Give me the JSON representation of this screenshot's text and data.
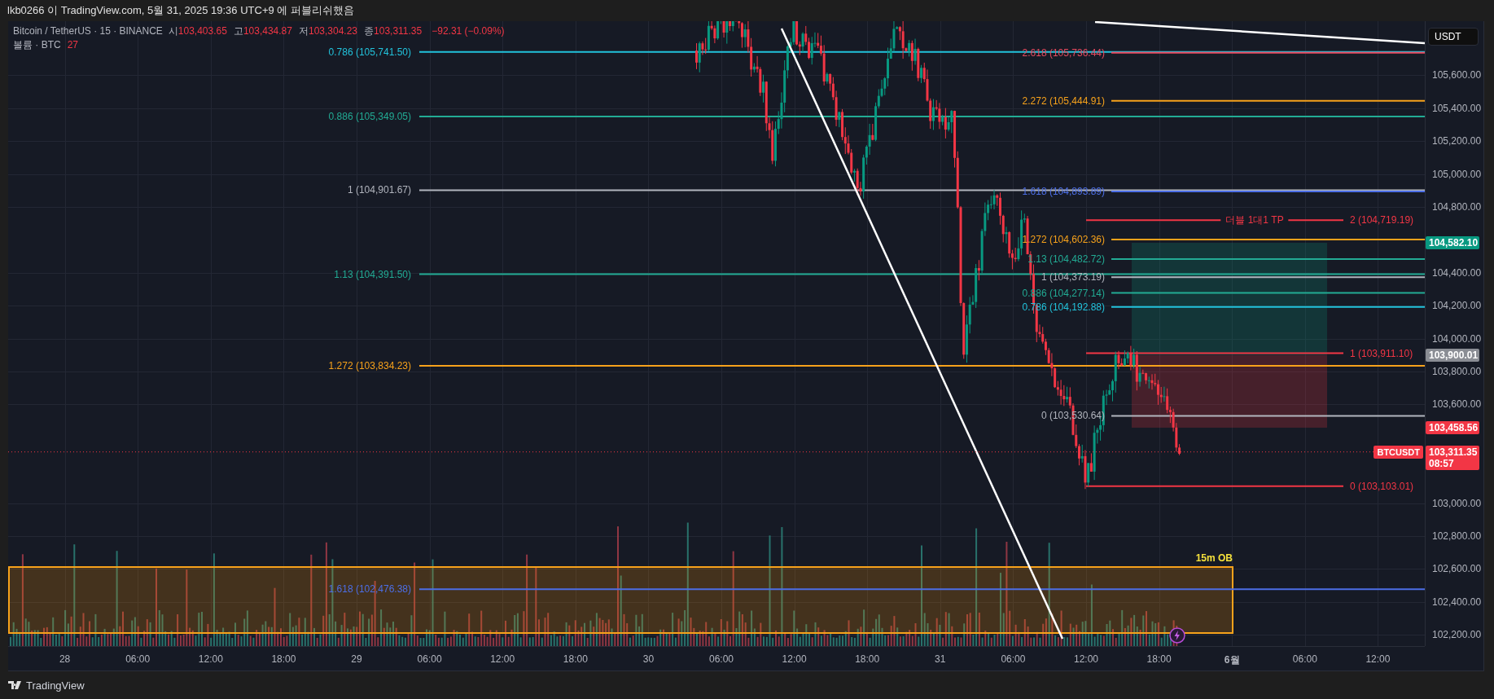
{
  "header": {
    "text": "lkb0266 이 TradingView.com, 5월 31, 2025 19:36 UTC+9 에 퍼블리쉬했음"
  },
  "legend": {
    "symbol": "Bitcoin / TetherUS · 15 · BINANCE",
    "ohlc": [
      {
        "label": "시",
        "value": "103,403.65"
      },
      {
        "label": "고",
        "value": "103,434.87"
      },
      {
        "label": "저",
        "value": "103,304.23"
      },
      {
        "label": "종",
        "value": "103,311.35"
      }
    ],
    "change": "−92.31 (−0.09%)"
  },
  "volume_legend": {
    "label": "볼륨 · BTC",
    "value": "27"
  },
  "currency": "USDT",
  "price_axis": {
    "ticks": [
      "105,600.00",
      "105,400.00",
      "105,200.00",
      "105,000.00",
      "104,800.00",
      "104,400.00",
      "104,200.00",
      "104,000.00",
      "103,800.00",
      "103,600.00",
      "103,000.00",
      "102,800.00",
      "102,600.00",
      "102,400.00",
      "102,200.00"
    ]
  },
  "time_axis": {
    "labels": [
      {
        "kind": "day",
        "text": "28"
      },
      {
        "kind": "time",
        "text": "06:00"
      },
      {
        "kind": "time",
        "text": "12:00"
      },
      {
        "kind": "time",
        "text": "18:00"
      },
      {
        "kind": "day",
        "text": "29"
      },
      {
        "kind": "time",
        "text": "06:00"
      },
      {
        "kind": "time",
        "text": "12:00"
      },
      {
        "kind": "time",
        "text": "18:00"
      },
      {
        "kind": "day",
        "text": "30"
      },
      {
        "kind": "time",
        "text": "06:00"
      },
      {
        "kind": "time",
        "text": "12:00"
      },
      {
        "kind": "time",
        "text": "18:00"
      },
      {
        "kind": "day",
        "text": "31"
      },
      {
        "kind": "time",
        "text": "06:00"
      },
      {
        "kind": "time",
        "text": "12:00"
      },
      {
        "kind": "time",
        "text": "18:00"
      },
      {
        "kind": "month",
        "text": "6월"
      },
      {
        "kind": "time",
        "text": "06:00"
      },
      {
        "kind": "time",
        "text": "12:00"
      }
    ]
  },
  "fib_levels": [
    {
      "kind": "left",
      "label": "0.786 (105,741.50)",
      "color": "#22c3dc"
    },
    {
      "kind": "left",
      "label": "0.886 (105,349.05)",
      "color": "#22ab94"
    },
    {
      "kind": "left",
      "label": "1 (104,901.67)",
      "color": "#b2b5be"
    },
    {
      "kind": "left",
      "label": "1.13 (104,391.50)",
      "color": "#22ab94"
    },
    {
      "kind": "left",
      "label": "1.272 (103,834.23)",
      "color": "#f7a21b"
    },
    {
      "kind": "left",
      "label": "1.618 (102,476.38)",
      "color": "#4c6ee6"
    },
    {
      "kind": "right",
      "label": "2.618 (105,736.44)",
      "color": "#e84a5f"
    },
    {
      "kind": "right",
      "label": "2.272 (105,444.91)",
      "color": "#f7a21b"
    },
    {
      "kind": "right",
      "label": "1.618 (104,893.89)",
      "color": "#4c6ee6"
    },
    {
      "kind": "right",
      "label": "1.272 (104,602.36)",
      "color": "#f7a21b"
    },
    {
      "kind": "right",
      "label": "1.13 (104,482.72)",
      "color": "#22ab94"
    },
    {
      "kind": "right",
      "label": "1 (104,373.19)",
      "color": "#b2b5be"
    },
    {
      "kind": "right",
      "label": "0.886 (104,277.14)",
      "color": "#22ab94"
    },
    {
      "kind": "right",
      "label": "0.786 (104,192.88)",
      "color": "#22c3dc"
    },
    {
      "kind": "right",
      "label": "0 (103,530.64)",
      "color": "#b2b5be"
    },
    {
      "kind": "target",
      "label": "2 (104,719.19)",
      "note": "더블 1대1 TP",
      "color": "#f23645"
    },
    {
      "kind": "target",
      "label": "1 (103,911.10)",
      "color": "#f23645"
    },
    {
      "kind": "target",
      "label": "0 (103,103.01)",
      "color": "#f23645"
    }
  ],
  "order_block": {
    "label": "15m OB"
  },
  "price_badges": [
    {
      "kind": "plain",
      "text": "104,582.10",
      "color": "#089981"
    },
    {
      "kind": "plain",
      "text": "103,900.01",
      "color": "#8a8d94"
    },
    {
      "kind": "plain",
      "text": "103,458.56",
      "color": "#f23645"
    },
    {
      "kind": "last",
      "text": "103,311.35",
      "countdown": "08:57",
      "symbol": "BTCUSDT",
      "color": "#f23645"
    }
  ],
  "footer": {
    "brand": "TradingView"
  }
}
